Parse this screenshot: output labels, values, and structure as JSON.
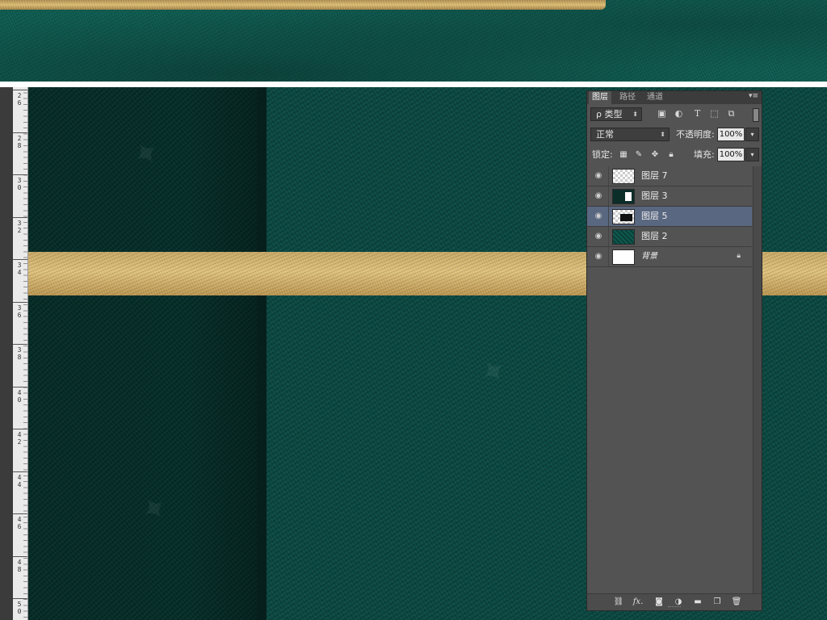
{
  "ruler": {
    "labels": [
      "26",
      "28",
      "30",
      "32",
      "34",
      "36",
      "38",
      "40",
      "42",
      "44",
      "46",
      "48",
      "50"
    ]
  },
  "layers_panel": {
    "tabs": [
      "图层",
      "路径",
      "通道"
    ],
    "menu_icon": "panel-menu-icon",
    "filter": {
      "kind_label": "ρ 类型",
      "icons": [
        "image-filter-icon",
        "adjustment-filter-icon",
        "type-filter-icon",
        "shape-filter-icon",
        "smart-object-filter-icon"
      ]
    },
    "blend_mode": "正常",
    "opacity_label": "不透明度:",
    "opacity_value": "100%",
    "lock_label": "锁定:",
    "lock_icons": [
      "lock-transparent-icon",
      "lock-paint-icon",
      "lock-move-icon",
      "lock-all-icon"
    ],
    "fill_label": "填充:",
    "fill_value": "100%",
    "layers": [
      {
        "name": "图层 7",
        "thumb": "checker",
        "selected": false
      },
      {
        "name": "图层 3",
        "thumb": "dark-shape",
        "selected": false
      },
      {
        "name": "图层 5",
        "thumb": "checker-shape",
        "selected": true
      },
      {
        "name": "图层 2",
        "thumb": "green",
        "selected": false
      },
      {
        "name": "背景",
        "thumb": "white",
        "selected": false,
        "locked": true
      }
    ],
    "footer_icons": [
      "link-layers-icon",
      "fx-icon",
      "layer-mask-icon",
      "adjustment-layer-icon",
      "new-group-icon",
      "new-layer-icon",
      "delete-layer-icon"
    ],
    "footer_fx": "fx."
  },
  "colors": {
    "gold": "#d2b46e",
    "teal": "#0c4842",
    "dark_teal": "#08302b",
    "panel_bg": "#535353",
    "selected_row": "#596780"
  }
}
